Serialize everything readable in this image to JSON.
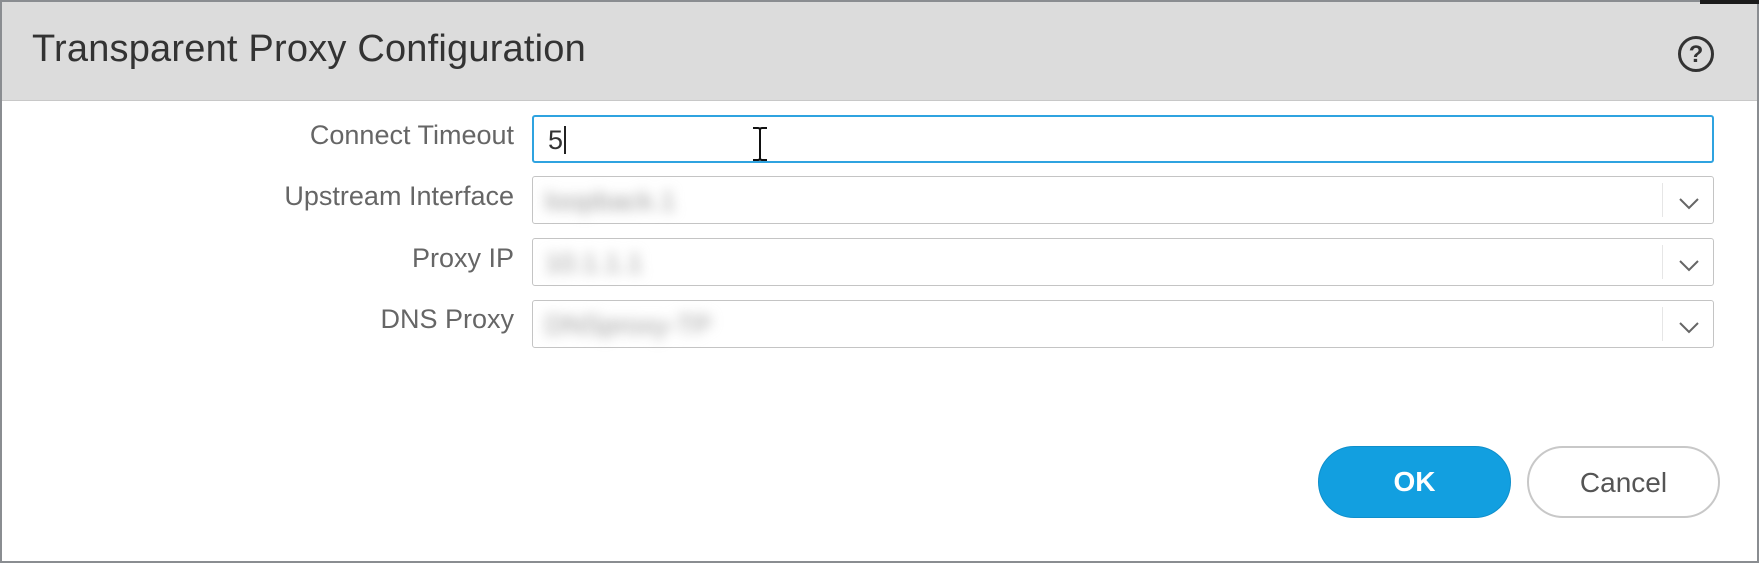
{
  "dialog": {
    "title": "Transparent Proxy Configuration",
    "help_icon": "help-circle-icon"
  },
  "form": {
    "connect_timeout": {
      "label": "Connect Timeout",
      "value": "5"
    },
    "upstream_interface": {
      "label": "Upstream Interface",
      "value": "loopback.1",
      "redacted": true
    },
    "proxy_ip": {
      "label": "Proxy IP",
      "value": "10.1.1.1",
      "redacted": true
    },
    "dns_proxy": {
      "label": "DNS Proxy",
      "value": "DNSproxy-TP",
      "redacted": true
    }
  },
  "buttons": {
    "ok_label": "OK",
    "cancel_label": "Cancel"
  },
  "colors": {
    "primary": "#129fe0",
    "focus_border": "#2fa3e0",
    "titlebar_bg": "#dcdcdc"
  }
}
